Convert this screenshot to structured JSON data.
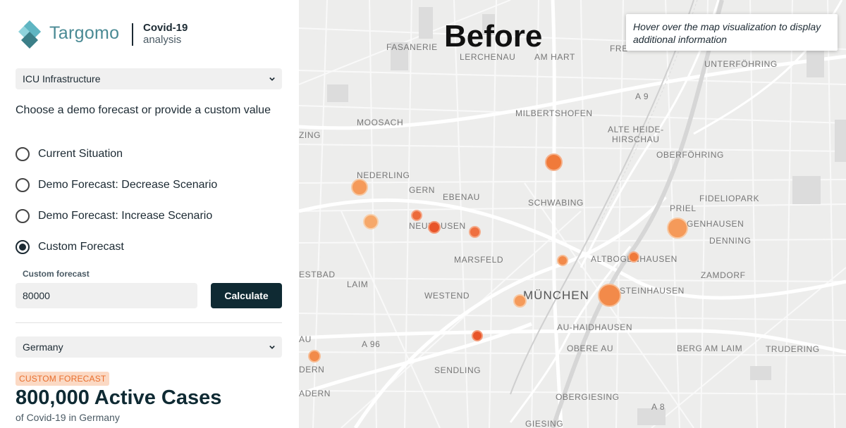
{
  "brand": {
    "name": "Targomo",
    "app_title": "Covid-19",
    "app_subtitle": "analysis"
  },
  "layer_select": {
    "value": "ICU Infrastructure"
  },
  "forecast": {
    "prompt": "Choose a demo forecast or provide a custom value",
    "options": [
      {
        "label": "Current Situation",
        "selected": false
      },
      {
        "label": "Demo Forecast: Decrease Scenario",
        "selected": false
      },
      {
        "label": "Demo Forecast: Increase Scenario",
        "selected": false
      },
      {
        "label": "Custom Forecast",
        "selected": true
      }
    ],
    "custom_label": "Custom forecast",
    "custom_value": "80000",
    "calculate_label": "Calculate"
  },
  "region_select": {
    "value": "Germany"
  },
  "summary": {
    "badge": "CUSTOM FORECAST",
    "headline": "800,000 Active Cases",
    "subline": "of Covid-19 in Germany"
  },
  "map": {
    "overlay_title": "Before",
    "tooltip": "Hover over the map visualization to display additional information",
    "labels": {
      "fasanerie": "FASANERIE",
      "lerchenau": "LERCHENAU",
      "amhart": "AM HART",
      "freimann": "FRE",
      "unterfohring": "UNTERFÖHRING",
      "a9_top": "A 9",
      "milbertshofen": "MILBERTSHOFEN",
      "moosach": "MOOSACH",
      "alteheide1": "ALTE HEIDE-",
      "alteheide2": "HIRSCHAU",
      "zing": "ZING",
      "oberfohring": "OBERFÖHRING",
      "nederling": "NEDERLING",
      "gern": "GERN",
      "ebenau": "EBENAU",
      "schwabing": "SCHWABING",
      "fideliopark": "FIDELIOPARK",
      "priel": "PRIEL",
      "bogenhausen": "GENHAUSEN",
      "neuhausen": "NEUHAUSEN",
      "denning": "DENNING",
      "marsfeld": "MARSFELD",
      "altbogenhausen": "ALTBOGENHAUSEN",
      "estbad": "ESTBAD",
      "zamdorf": "ZAMDORF",
      "laim": "LAIM",
      "westend": "WESTEND",
      "muenchen": "MÜNCHEN",
      "steinhausen": "STEINHAUSEN",
      "au_haidhausen": "AU-HAIDHAUSEN",
      "au": "AU",
      "a96": "A 96",
      "obere_au": "OBERE AU",
      "berg_am_laim": "BERG AM LAIM",
      "trudering": "TRUDERING",
      "dern": "DERN",
      "sendling": "SENDLING",
      "adern": "ADERN",
      "obergiesing": "OBERGIESING",
      "a8": "A 8",
      "giesing": "GIESING"
    }
  },
  "colors": {
    "accent": "#0f2a33",
    "bubble_light": "#f5a05c",
    "bubble_mid": "#f28a4a",
    "bubble_dark": "#e8552a",
    "badge_text": "#e86e2d",
    "badge_bg": "#fbd9c4"
  }
}
